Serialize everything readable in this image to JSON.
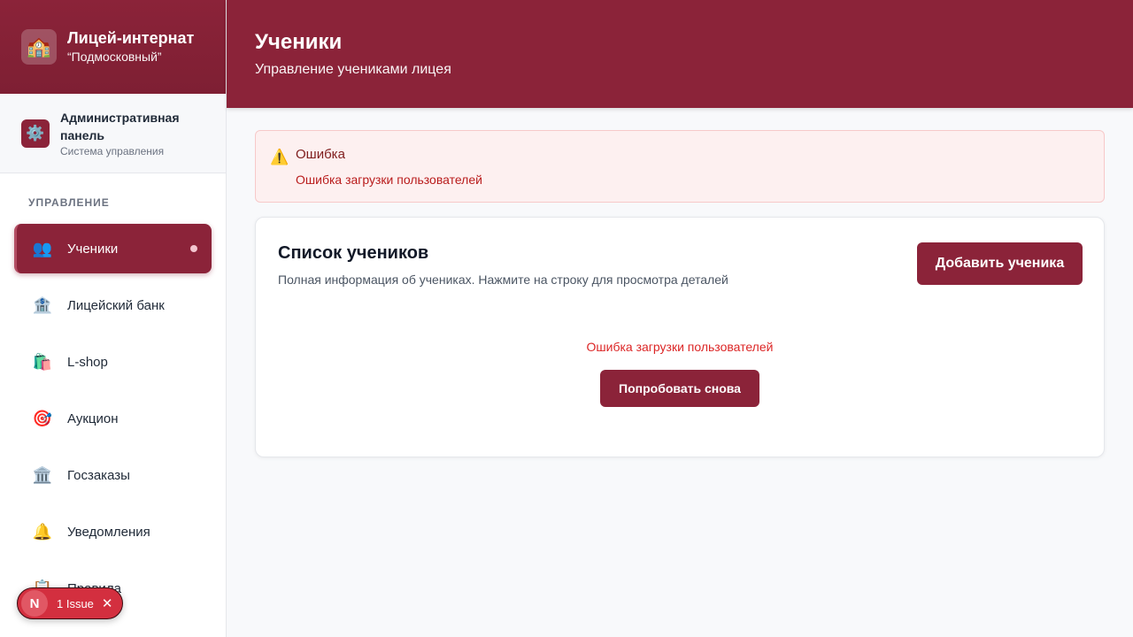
{
  "brand": {
    "title": "Лицей-интернат",
    "subtitle": "“Подмосковный”",
    "logo_icon": "🏫"
  },
  "admin": {
    "title": "Административная панель",
    "subtitle": "Система управления",
    "icon": "⚙️"
  },
  "sidebar": {
    "section_label": "УПРАВЛЕНИЕ",
    "items": [
      {
        "label": "Ученики",
        "icon": "👥",
        "active": true
      },
      {
        "label": "Лицейский банк",
        "icon": "🏦"
      },
      {
        "label": "L-shop",
        "icon": "🛍️"
      },
      {
        "label": "Аукцион",
        "icon": "🎯"
      },
      {
        "label": "Госзаказы",
        "icon": "🏛️"
      },
      {
        "label": "Уведомления",
        "icon": "🔔"
      },
      {
        "label": "Правила",
        "icon": "📋"
      }
    ]
  },
  "header": {
    "title": "Ученики",
    "subtitle": "Управление учениками лицея"
  },
  "alert": {
    "title": "Ошибка",
    "message": "Ошибка загрузки пользователей",
    "icon": "⚠️"
  },
  "card": {
    "title": "Список учеников",
    "description": "Полная информация об учениках. Нажмите на строку для просмотра деталей",
    "add_button": "Добавить ученика",
    "error_text": "Ошибка загрузки пользователей",
    "retry_button": "Попробовать снова"
  },
  "issues": {
    "logo": "N",
    "label": "1 Issue",
    "close": "✕"
  },
  "colors": {
    "brand": "#8b2339",
    "error": "#dc2626",
    "alert_bg": "#fdf0f0"
  }
}
